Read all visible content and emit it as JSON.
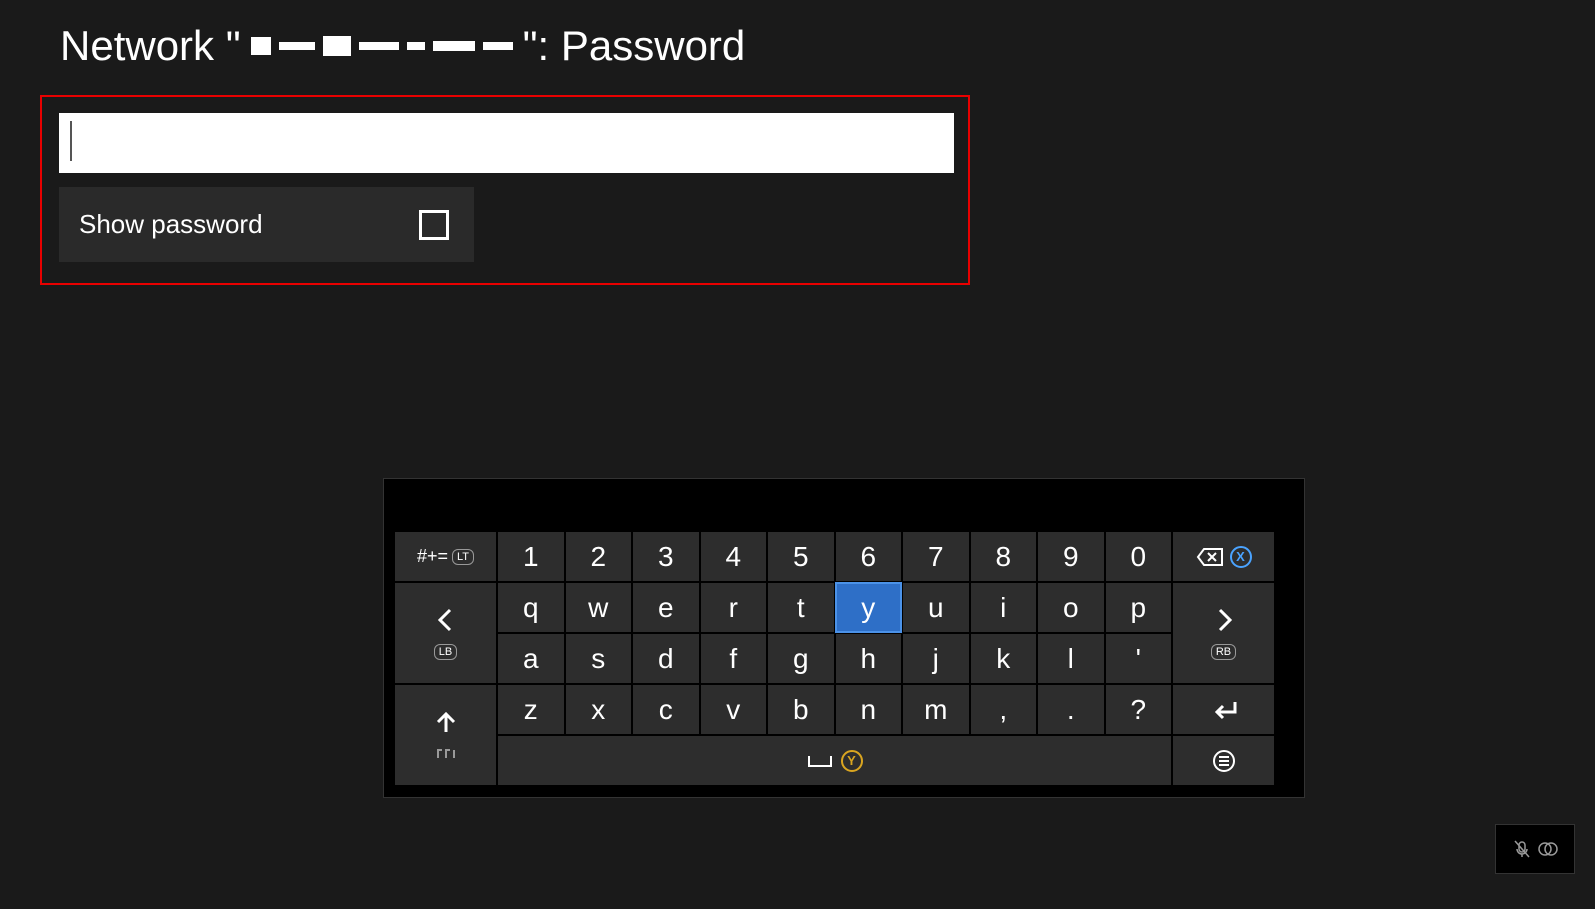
{
  "title": {
    "prefix": "Network \"",
    "suffix": "\": Password"
  },
  "form": {
    "password_value": "",
    "show_password_label": "Show password",
    "show_password_checked": false
  },
  "keyboard": {
    "symbols_key": "#+=",
    "lt_badge": "LT",
    "lb_badge": "LB",
    "rb_badge": "RB",
    "x_badge": "X",
    "y_badge": "Y",
    "row0": [
      "1",
      "2",
      "3",
      "4",
      "5",
      "6",
      "7",
      "8",
      "9",
      "0"
    ],
    "row1": [
      "q",
      "w",
      "e",
      "r",
      "t",
      "y",
      "u",
      "i",
      "o",
      "p"
    ],
    "row2": [
      "a",
      "s",
      "d",
      "f",
      "g",
      "h",
      "j",
      "k",
      "l",
      "'"
    ],
    "row3": [
      "z",
      "x",
      "c",
      "v",
      "b",
      "n",
      "m",
      ",",
      ".",
      "?"
    ],
    "highlighted_key": "y"
  }
}
